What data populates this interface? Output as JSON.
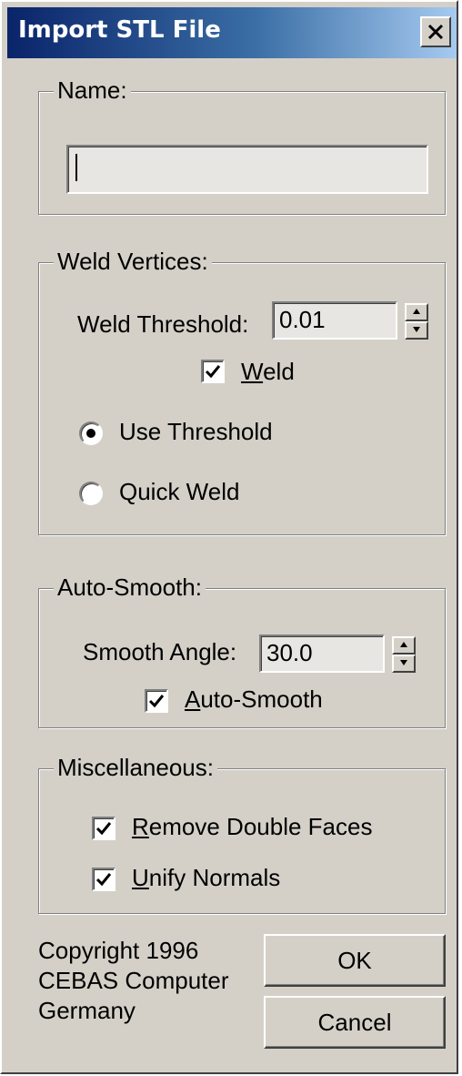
{
  "window": {
    "title": "Import STL File",
    "close_label": "close"
  },
  "name_group": {
    "label": "Name:",
    "value": ""
  },
  "weld_group": {
    "label": "Weld Vertices:",
    "threshold_label": "Weld Threshold:",
    "threshold_value": "0.01",
    "weld_checkbox": {
      "label_accel": "W",
      "label_rest": "eld",
      "checked": true
    },
    "radio_options": [
      {
        "label": "Use Threshold",
        "selected": true
      },
      {
        "label": "Quick Weld",
        "selected": false
      }
    ]
  },
  "smooth_group": {
    "label": "Auto-Smooth:",
    "angle_label": "Smooth Angle:",
    "angle_value": "30.0",
    "smooth_checkbox": {
      "label_accel": "A",
      "label_rest": "uto-Smooth",
      "checked": true
    }
  },
  "misc_group": {
    "label": "Miscellaneous:",
    "remove_double_faces": {
      "label_accel": "R",
      "label_rest": "emove Double Faces",
      "checked": true
    },
    "unify_normals": {
      "label_accel": "U",
      "label_rest": "nify Normals",
      "checked": true
    }
  },
  "copyright": {
    "line1": "Copyright 1996",
    "line2": "CEBAS Computer",
    "line3": "Germany"
  },
  "buttons": {
    "ok": "OK",
    "cancel": "Cancel"
  }
}
